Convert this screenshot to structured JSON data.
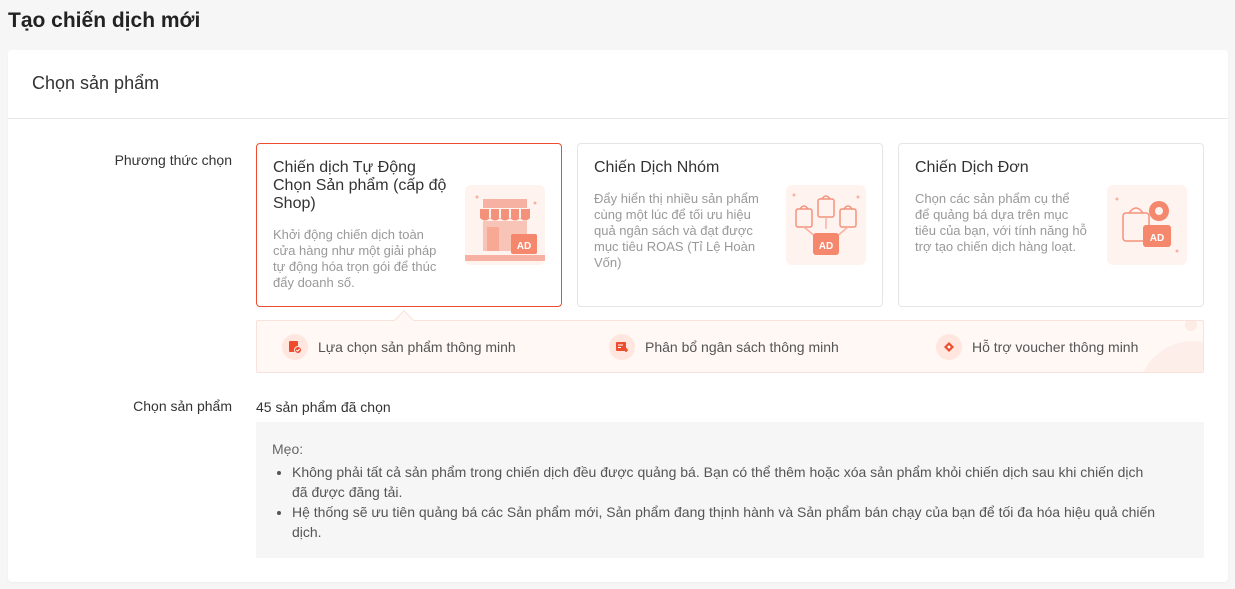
{
  "page": {
    "title": "Tạo chiến dịch mới"
  },
  "section": {
    "title": "Chọn sản phẩm"
  },
  "method": {
    "label": "Phương thức chọn",
    "cards": [
      {
        "title": "Chiến dịch Tự Động Chọn Sản phẩm (cấp độ Shop)",
        "desc": "Khởi động chiến dịch toàn cửa hàng như một giải pháp tự động hóa trọn gói để thúc đẩy doanh số.",
        "icon": "storefront-ad-icon",
        "selected": true
      },
      {
        "title": "Chiến Dịch Nhóm",
        "desc": "Đẩy hiển thị nhiều sản phẩm cùng một lúc để tối ưu hiệu quả ngân sách và đạt được mục tiêu ROAS (Tỉ Lệ Hoàn Vốn)",
        "icon": "shopping-bags-ad-icon",
        "selected": false
      },
      {
        "title": "Chiến Dịch Đơn",
        "desc": "Chọn các sản phẩm cụ thể để quảng bá dựa trên mục tiêu của bạn, với tính năng hỗ trợ tạo chiến dịch hàng loạt.",
        "icon": "bag-gear-ad-icon",
        "selected": false
      }
    ],
    "features": [
      {
        "label": "Lựa chọn sản phẩm thông minh",
        "icon": "product-check-icon"
      },
      {
        "label": "Phân bổ ngân sách thông minh",
        "icon": "budget-plus-icon"
      },
      {
        "label": "Hỗ trợ voucher thông minh",
        "icon": "voucher-icon"
      }
    ]
  },
  "products": {
    "label": "Chọn sản phẩm",
    "count_text": "45 sản phẩm đã chọn",
    "tips_title": "Mẹo:",
    "tips": [
      "Không phải tất cả sản phẩm trong chiến dịch đều được quảng bá. Bạn có thể thêm hoặc xóa sản phẩm khỏi chiến dịch sau khi chiến dịch đã được đăng tải.",
      "Hệ thống sẽ ưu tiên quảng bá các Sản phẩm mới, Sản phẩm đang thịnh hành và Sản phẩm bán chạy của bạn để tối đa hóa hiệu quả chiến dịch."
    ]
  },
  "colors": {
    "accent": "#ee4d2d",
    "icon_light": "#f8b7a8",
    "tile_bg": "#fff3f0",
    "feature_bg": "#fff8f5"
  }
}
